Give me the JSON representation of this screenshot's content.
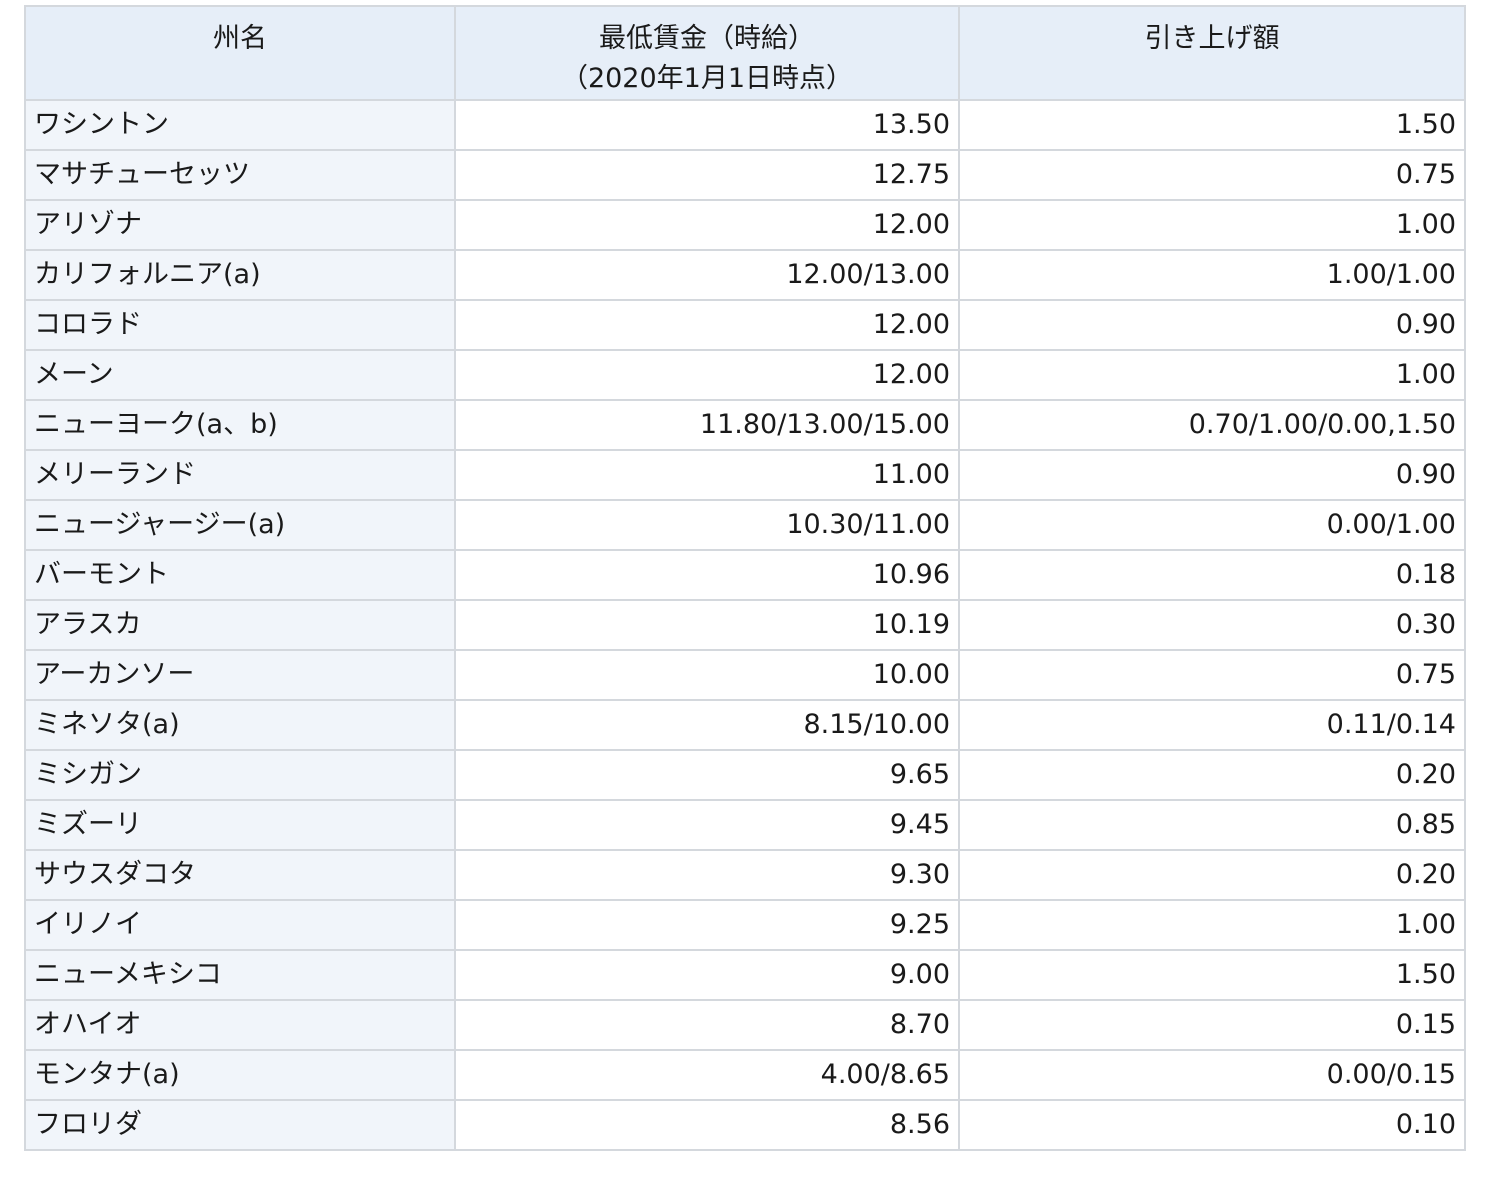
{
  "table": {
    "headers": {
      "state": "州名",
      "wage_line1": "最低賃金（時給）",
      "wage_line2": "（2020年1月1日時点）",
      "raise": "引き上げ額"
    },
    "rows": [
      {
        "state": "ワシントン",
        "wage": "13.50",
        "raise": "1.50"
      },
      {
        "state": "マサチューセッツ",
        "wage": "12.75",
        "raise": "0.75"
      },
      {
        "state": "アリゾナ",
        "wage": "12.00",
        "raise": "1.00"
      },
      {
        "state": "カリフォルニア(a)",
        "wage": "12.00/13.00",
        "raise": "1.00/1.00"
      },
      {
        "state": "コロラド",
        "wage": "12.00",
        "raise": "0.90"
      },
      {
        "state": "メーン",
        "wage": "12.00",
        "raise": "1.00"
      },
      {
        "state": "ニューヨーク(a、b)",
        "wage": "11.80/13.00/15.00",
        "raise": "0.70/1.00/0.00,1.50"
      },
      {
        "state": "メリーランド",
        "wage": "11.00",
        "raise": "0.90"
      },
      {
        "state": "ニュージャージー(a)",
        "wage": "10.30/11.00",
        "raise": "0.00/1.00"
      },
      {
        "state": "バーモント",
        "wage": "10.96",
        "raise": "0.18"
      },
      {
        "state": "アラスカ",
        "wage": "10.19",
        "raise": "0.30"
      },
      {
        "state": "アーカンソー",
        "wage": "10.00",
        "raise": "0.75"
      },
      {
        "state": "ミネソタ(a)",
        "wage": "8.15/10.00",
        "raise": "0.11/0.14"
      },
      {
        "state": "ミシガン",
        "wage": "9.65",
        "raise": "0.20"
      },
      {
        "state": "ミズーリ",
        "wage": "9.45",
        "raise": "0.85"
      },
      {
        "state": "サウスダコタ",
        "wage": "9.30",
        "raise": "0.20"
      },
      {
        "state": "イリノイ",
        "wage": "9.25",
        "raise": "1.00"
      },
      {
        "state": "ニューメキシコ",
        "wage": "9.00",
        "raise": "1.50"
      },
      {
        "state": "オハイオ",
        "wage": "8.70",
        "raise": "0.15"
      },
      {
        "state": "モンタナ(a)",
        "wage": "4.00/8.65",
        "raise": "0.00/0.15"
      },
      {
        "state": "フロリダ",
        "wage": "8.56",
        "raise": "0.10"
      }
    ]
  }
}
